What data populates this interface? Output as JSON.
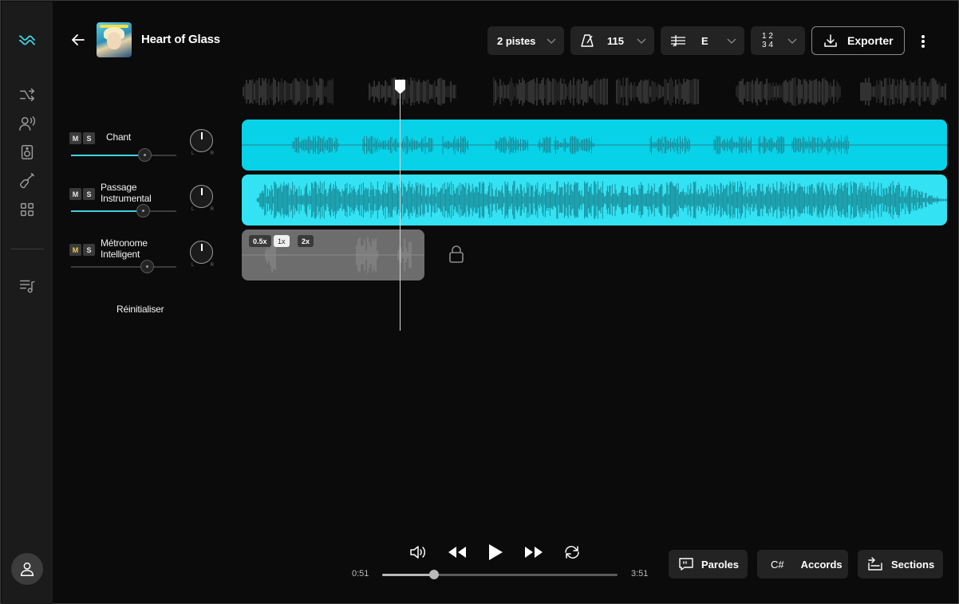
{
  "song": {
    "title": "Heart of Glass"
  },
  "header": {
    "tracks_label": "2 pistes",
    "tempo": "115",
    "key": "E",
    "time_signature": [
      "1 2",
      "3 4"
    ],
    "export_label": "Exporter"
  },
  "tracks": [
    {
      "name": "Chant",
      "volume": 0.7,
      "muted": false,
      "solo": false,
      "color": "#08d2e8"
    },
    {
      "name_lines": [
        "Passage",
        "Instrumental"
      ],
      "volume": 0.68,
      "muted": false,
      "solo": false,
      "color": "#33e3f4"
    },
    {
      "name_lines": [
        "Métronome",
        "Intelligent"
      ],
      "volume": 0.72,
      "muted": true,
      "solo": false,
      "color": "#6d6d6d"
    }
  ],
  "mute_label": "M",
  "solo_label": "S",
  "pan_left": "L",
  "pan_right": "R",
  "metronome_speeds": [
    "0.5x",
    "1x",
    "2x"
  ],
  "metronome_selected_speed": "1x",
  "reset_label": "Réinitialiser",
  "playback": {
    "current": "0:51",
    "total": "3:51",
    "progress": 0.2208
  },
  "tools": {
    "lyrics": "Paroles",
    "chords_chip": "C#",
    "chords": "Accords",
    "sections": "Sections"
  },
  "icons": {
    "sidebar": [
      "logo-waves-icon",
      "shuffle-split-icon",
      "voice-user-icon",
      "speaker-icon",
      "guitar-icon",
      "grid-apps-icon",
      "playlist-music-icon",
      "user-icon"
    ],
    "header": [
      "back-arrow-icon",
      "metronome-icon",
      "equalizer-icon",
      "chevron-down-icon",
      "download-icon",
      "more-vertical-icon"
    ],
    "transport": [
      "volume-icon",
      "rewind-icon",
      "play-icon",
      "fast-forward-icon",
      "loop-icon"
    ],
    "tools": [
      "lyrics-quote-icon",
      "sections-icon",
      "lock-icon"
    ]
  },
  "colors": {
    "accent": "#3fd0e0",
    "background": "#0b0b0b",
    "panel": "#1b1b1b"
  }
}
